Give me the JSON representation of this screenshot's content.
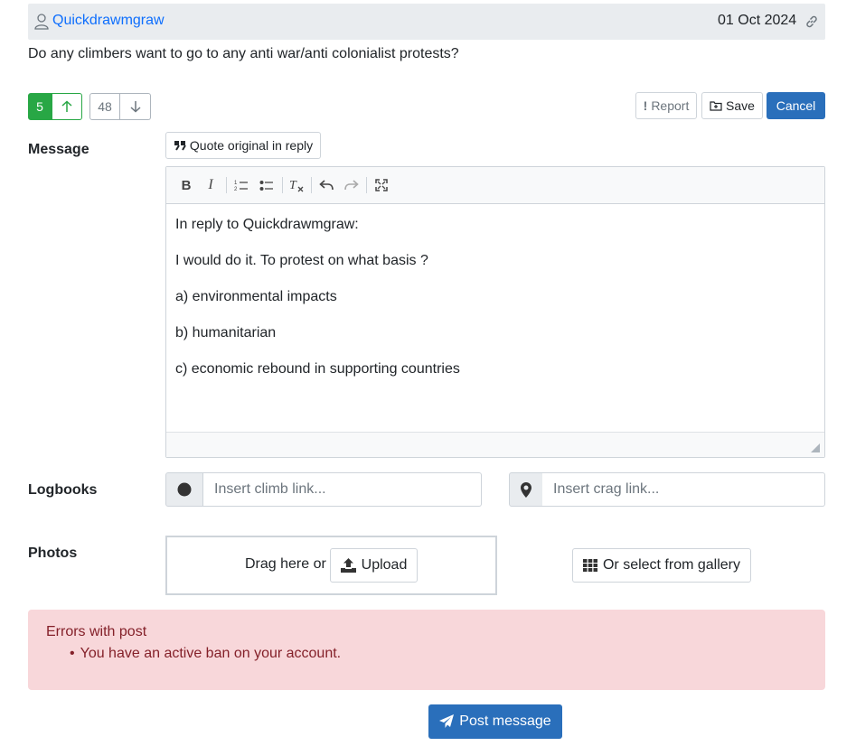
{
  "post": {
    "author": "Quickdrawmgraw",
    "date": "01 Oct 2024",
    "body": "Do any climbers want to go to any anti war/anti colonialist  protests?"
  },
  "votes": {
    "up": "5",
    "down": "48"
  },
  "actions": {
    "report": "Report",
    "save": "Save",
    "cancel": "Cancel"
  },
  "form": {
    "message_label": "Message",
    "quote_label": "Quote original in reply",
    "editor_lines": [
      "In reply to Quickdrawmgraw:",
      "I would do it. To protest on what basis ?",
      "a) environmental impacts",
      "b) humanitarian",
      "c) economic rebound in supporting countries"
    ],
    "logbooks_label": "Logbooks",
    "climb_placeholder": "Insert climb link...",
    "crag_placeholder": "Insert crag link...",
    "photos_label": "Photos",
    "drag_text": "Drag here or",
    "upload_label": "Upload",
    "gallery_label": "Or select from gallery"
  },
  "errors": {
    "title": "Errors with post",
    "items": [
      "You have an active ban on your account."
    ]
  },
  "submit_label": "Post message",
  "colors": {
    "primary": "#2a6fbb",
    "success": "#28a745",
    "danger_bg": "#f8d7da",
    "danger_text": "#842029"
  }
}
